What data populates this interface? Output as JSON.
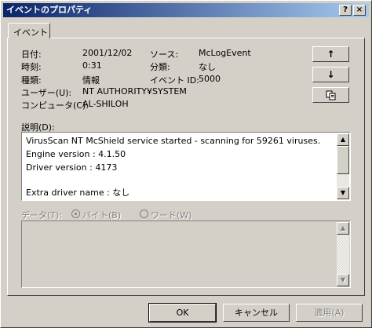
{
  "window": {
    "title": "イベントのプロパティ",
    "help_button": "?",
    "close_button": "×"
  },
  "tab": {
    "label": "イベント"
  },
  "fields": {
    "date_label": "日付:",
    "date_value": "2001/12/02",
    "time_label": "時刻:",
    "time_value": "0:31",
    "type_label": "種類:",
    "type_value": "情報",
    "user_label": "ユーザー(U):",
    "user_value": "NT AUTHORITY¥SYSTEM",
    "computer_label": "コンピュータ(C):",
    "computer_value": "AL-SHILOH",
    "source_label": "ソース:",
    "source_value": "McLogEvent",
    "category_label": "分類:",
    "category_value": "なし",
    "event_id_label": "イベント ID:",
    "event_id_value": "5000"
  },
  "nav": {
    "up_icon": "↑",
    "down_icon": "↓",
    "copy_icon": "copy-icon"
  },
  "description": {
    "label": "説明(D):",
    "lines": [
      "VirusScan NT McShield service started - scanning for 59261 viruses.",
      "Engine version : 4.1.50",
      "Driver version : 4173",
      "",
      "Extra driver name : なし"
    ]
  },
  "data_section": {
    "label": "データ(T):",
    "bytes_label": "バイト(B)",
    "words_label": "ワード(W)"
  },
  "buttons": {
    "ok": "OK",
    "cancel": "キャンセル",
    "apply": "適用(A)"
  }
}
